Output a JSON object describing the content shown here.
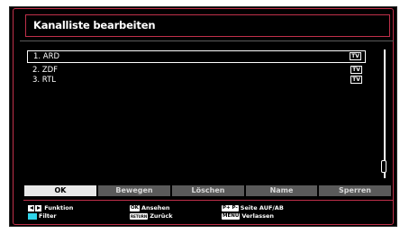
{
  "title": "Kanalliste bearbeiten",
  "channels": [
    {
      "label": "1. ARD",
      "badge": "TV",
      "selected": true
    },
    {
      "label": "2. ZDF",
      "badge": "TV",
      "selected": false
    },
    {
      "label": "3. RTL",
      "badge": "TV",
      "selected": false
    }
  ],
  "buttons": [
    {
      "label": "OK",
      "active": true
    },
    {
      "label": "Bewegen",
      "active": false
    },
    {
      "label": "Löschen",
      "active": false
    },
    {
      "label": "Name",
      "active": false
    },
    {
      "label": "Sperren",
      "active": false
    }
  ],
  "help": {
    "funktion": "Funktion",
    "filter": "Filter",
    "ok_key": "OK",
    "ansehen": "Ansehen",
    "return_key": "RETURN",
    "zurueck": "Zurück",
    "page_key": "P+ P-",
    "seite": "Seite AUF/AB",
    "menu_key": "MENU",
    "verlassen": "Verlassen"
  },
  "colors": {
    "accent": "#c0304a",
    "background": "#000000",
    "filter_key": "#2fd3e8"
  }
}
